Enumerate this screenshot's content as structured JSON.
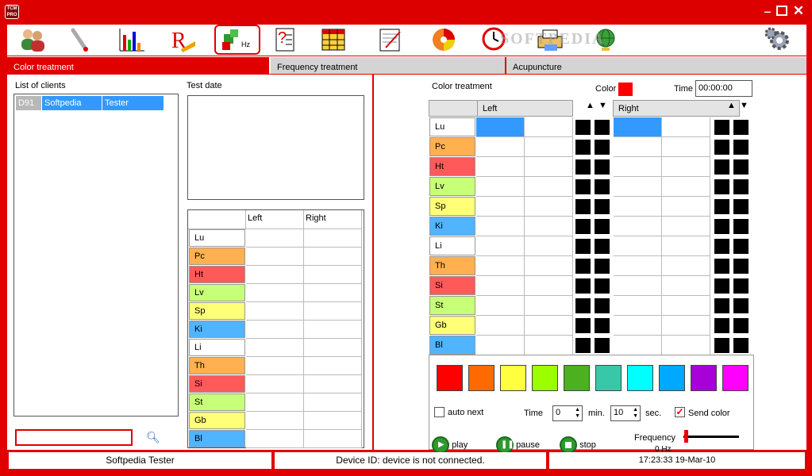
{
  "titlebar": {
    "logo_text": "TCM PRO"
  },
  "tabs": [
    "Color treatment",
    "Frequency treatment",
    "Acupuncture"
  ],
  "clients": {
    "label": "List of clients",
    "rows": [
      {
        "id": "D91",
        "first": "Softpedia",
        "last": "Tester"
      }
    ],
    "search_value": ""
  },
  "testdate": {
    "label": "Test date"
  },
  "left_table": {
    "col_left": "Left",
    "col_right": "Right"
  },
  "meridians": [
    "Lu",
    "Pc",
    "Ht",
    "Lv",
    "Sp",
    "Ki",
    "Li",
    "Th",
    "Si",
    "St",
    "Gb",
    "Bl"
  ],
  "meridian_colors": [
    "#ffffff",
    "#ffb050",
    "#ff5a5a",
    "#c8ff78",
    "#ffff78",
    "#50b4ff",
    "#ffffff",
    "#ffb050",
    "#ff5a5a",
    "#c8ff78",
    "#ffff78",
    "#50b4ff"
  ],
  "color_treatment": {
    "title": "Color treatment",
    "color_label": "Color",
    "color_value": "#ff0000",
    "time_label": "Time",
    "time_value": "00:00:00",
    "left_header": "Left",
    "right_header": "Right"
  },
  "swatches": [
    "#ff0000",
    "#ff6a00",
    "#ffff40",
    "#9cff00",
    "#4cb020",
    "#38c8a8",
    "#00ffff",
    "#00a8ff",
    "#a800d8",
    "#ff00ff"
  ],
  "controls": {
    "auto_next": "auto next",
    "time_label": "Time",
    "min_value": "0",
    "min_label": "min.",
    "sec_value": "10",
    "sec_label": "sec.",
    "send_color": "Send color",
    "play": "play",
    "pause": "pause",
    "stop": "stop",
    "frequency_label": "Frequency",
    "frequency_value": "0 Hz"
  },
  "status": {
    "user": "Softpedia Tester",
    "device": "Device ID: device is not connected.",
    "datetime": "17:23:33  19-Mar-10"
  },
  "watermark": "SOFTPEDIA"
}
